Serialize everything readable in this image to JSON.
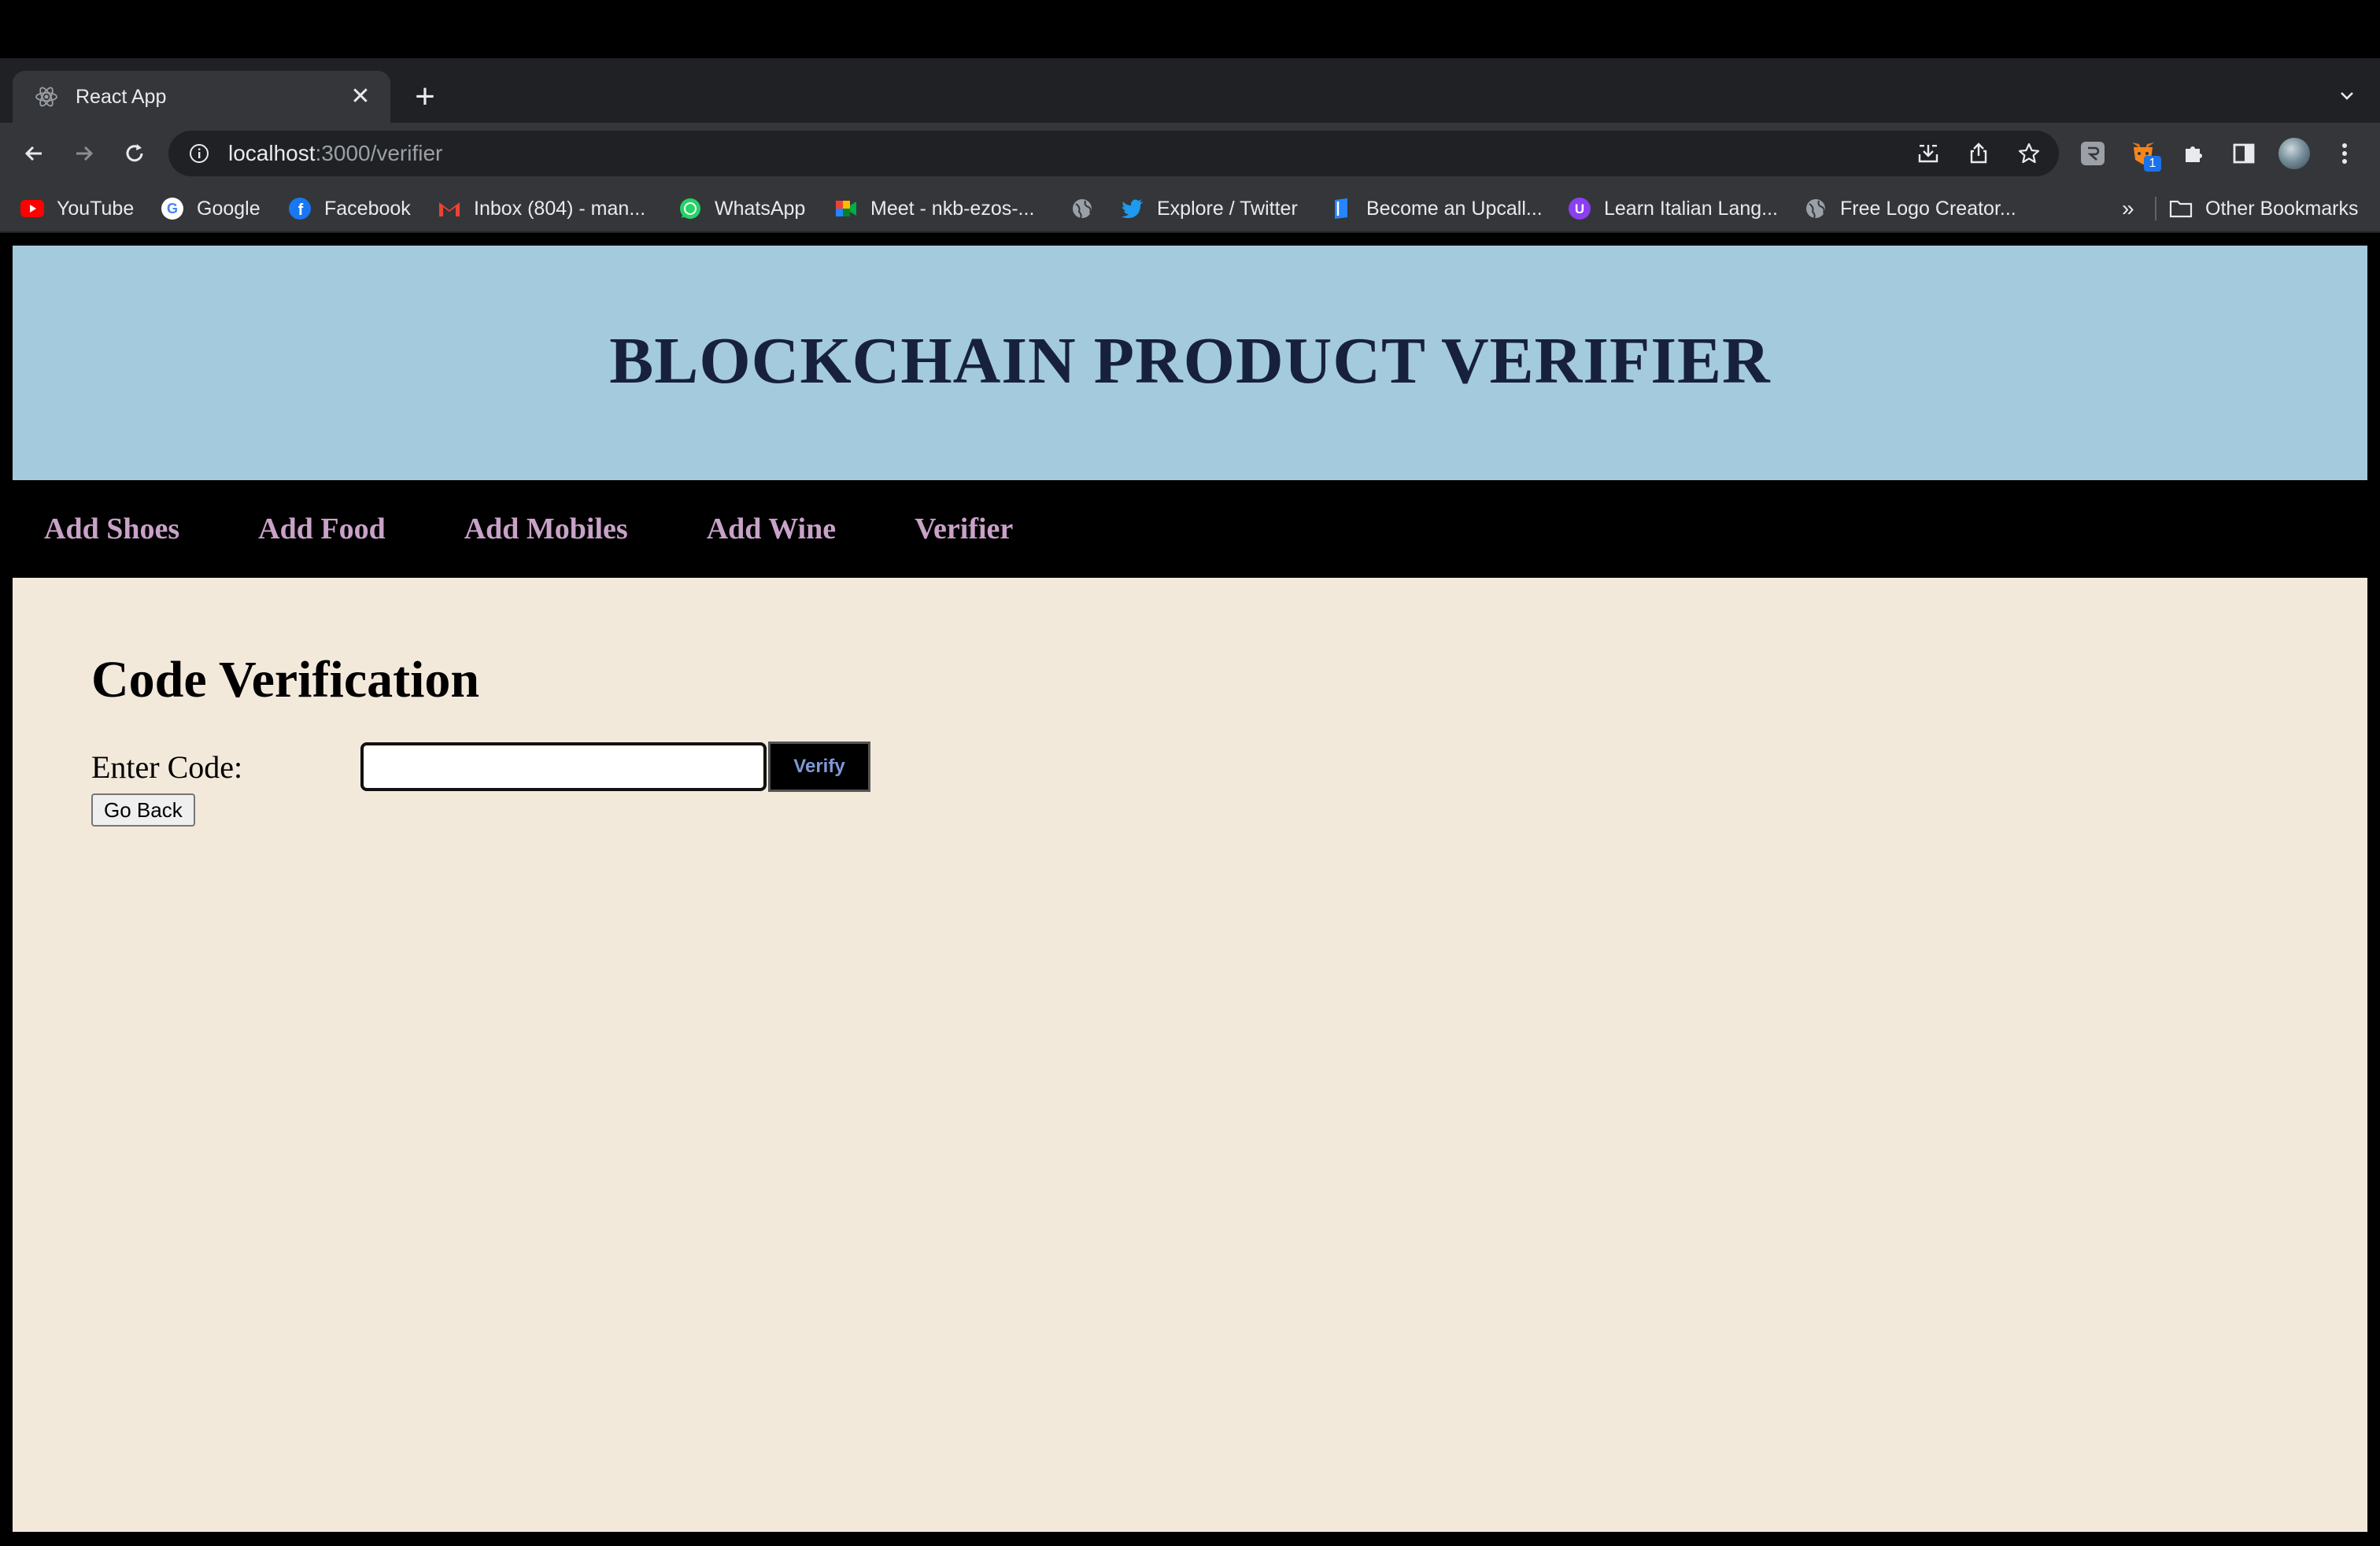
{
  "browser": {
    "tab": {
      "title": "React App",
      "close_glyph": "✕",
      "favicon": "react-icon"
    },
    "new_tab_glyph": "+",
    "address": {
      "host": "localhost",
      "path": ":3000/verifier"
    },
    "bookmarks": [
      {
        "label": "YouTube",
        "icon": "youtube-icon"
      },
      {
        "label": "Google",
        "icon": "google-icon"
      },
      {
        "label": "Facebook",
        "icon": "facebook-icon"
      },
      {
        "label": "Inbox (804) - man...",
        "icon": "gmail-icon"
      },
      {
        "label": "WhatsApp",
        "icon": "whatsapp-icon"
      },
      {
        "label": "Meet - nkb-ezos-...",
        "icon": "meet-icon"
      },
      {
        "label": "",
        "icon": "globe-icon"
      },
      {
        "label": "Explore / Twitter",
        "icon": "twitter-icon"
      },
      {
        "label": "Become an Upcall...",
        "icon": "upcall-icon"
      },
      {
        "label": "Learn Italian Lang...",
        "icon": "learn-icon"
      },
      {
        "label": "Free Logo Creator...",
        "icon": "globe-icon"
      }
    ],
    "bookmarks_overflow": "»",
    "other_bookmarks": "Other Bookmarks",
    "extension_badge": "1",
    "colors": {
      "tabstrip": "#202124",
      "toolbar": "#35363a",
      "text": "#e8eaed"
    }
  },
  "site": {
    "title": "BLOCKCHAIN PRODUCT VERIFIER",
    "nav": [
      "Add Shoes",
      "Add Food",
      "Add Mobiles",
      "Add Wine",
      "Verifier"
    ],
    "heading": "Code Verification",
    "code_label": "Enter Code:",
    "code_value": "",
    "verify_label": "Verify",
    "back_label": "Go Back",
    "colors": {
      "header_bg": "#a4cadd",
      "title": "#17213d",
      "nav_bg": "#000000",
      "nav_link": "#c9a2c8",
      "page_bg": "#f3e9db",
      "verify_text": "#7e9ad6"
    }
  }
}
